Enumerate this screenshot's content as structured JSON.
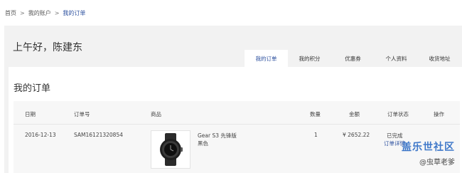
{
  "breadcrumb": {
    "items": [
      "首页",
      "我的账户",
      "我的订单"
    ],
    "separator": ">"
  },
  "greeting": "上午好，陈建东",
  "tabs": [
    "我的订单",
    "我的积分",
    "优惠券",
    "个人资料",
    "收货地址"
  ],
  "active_tab_index": 0,
  "section_title": "我的订单",
  "table": {
    "headers": {
      "date": "日期",
      "order_no": "订单号",
      "product": "商品",
      "quantity": "数量",
      "amount": "金额",
      "status": "订单状态",
      "action": "操作"
    },
    "rows": [
      {
        "date": "2016-12-13",
        "order_no": "SAM16121320854",
        "product_name": "Gear S3 先锋版",
        "product_color": "黑色",
        "quantity": "1",
        "amount": "¥ 2652.22",
        "status": "已完成",
        "detail_link": "订单详情"
      }
    ]
  },
  "watermark": {
    "line1": "盖乐世社区",
    "line2": "@虫草老爹"
  },
  "colors": {
    "accent": "#2b4f9e",
    "panel_bg": "#f2f2f2",
    "table_bg": "#f7f7f7",
    "watermark": "#3f78c9"
  }
}
